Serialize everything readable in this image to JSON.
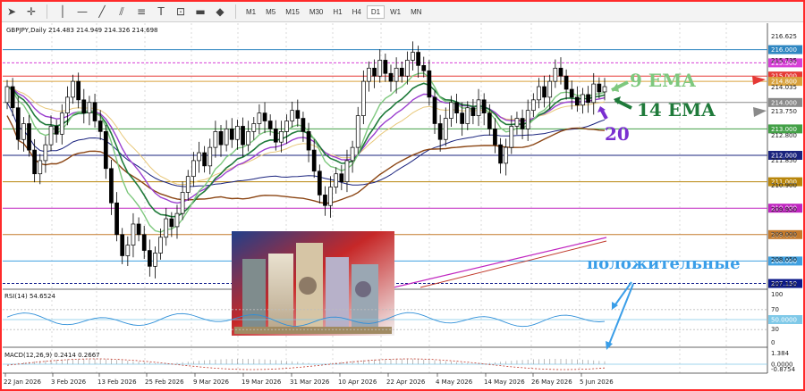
{
  "toolbar": {
    "timeframes": [
      "M1",
      "M5",
      "M15",
      "M30",
      "H1",
      "H4",
      "D1",
      "W1",
      "MN"
    ],
    "active_timeframe": "D1",
    "tools": [
      "cursor-icon",
      "crosshair-icon",
      "vertical-line-icon",
      "horizontal-line-icon",
      "trendline-icon",
      "channel-icon",
      "fibonacci-icon",
      "text-icon",
      "label-icon",
      "rectangle-icon",
      "shapes-icon"
    ]
  },
  "chart_header": "GBPJPY,Daily  214.483 214.949 214.326 214.698",
  "price_axis": {
    "labels": [
      "216.625",
      "215.735",
      "214.035",
      "213.750",
      "212.800",
      "211.850",
      "210.900",
      "209.950",
      "209.000",
      "208.050",
      "207.150"
    ],
    "levels": [
      {
        "price": "216.000",
        "color": "#2e86c1"
      },
      {
        "price": "215.500",
        "color": "#d63fd6"
      },
      {
        "price": "215.000",
        "color": "#e53935"
      },
      {
        "price": "214.800",
        "color": "#d9a23d"
      },
      {
        "price": "214.000",
        "color": "#8a8a8a"
      },
      {
        "price": "213.000",
        "color": "#43a047"
      },
      {
        "price": "212.000",
        "color": "#1a237e"
      },
      {
        "price": "211.000",
        "color": "#b8860b"
      },
      {
        "price": "210.000",
        "color": "#c026c0"
      },
      {
        "price": "209.000",
        "color": "#c47a2c"
      },
      {
        "price": "208.000",
        "color": "#3fa0e0"
      },
      {
        "price": "207.150",
        "color": "#0d1a8a"
      }
    ]
  },
  "annotations": {
    "ema9": "9 EMA",
    "ema14": "14 EMA",
    "ema20": "20",
    "positive": "положительные"
  },
  "rsi": {
    "header": "RSI(14) 54.6524",
    "scale": [
      "100",
      "70",
      "50",
      "30",
      "0"
    ],
    "current": "50.0000"
  },
  "macd": {
    "header": "MACD(12,26,9) 0.2414 0.2667",
    "scale": [
      "1.384",
      "0.0000",
      "-0.8754"
    ]
  },
  "date_axis": [
    "22 Jan 2026",
    "3 Feb 2026",
    "13 Feb 2026",
    "25 Feb 2026",
    "9 Mar 2026",
    "19 Mar 2026",
    "31 Mar 2026",
    "10 Apr 2026",
    "22 Apr 2026",
    "4 May 2026",
    "14 May 2026",
    "26 May 2026",
    "5 Jun 2026"
  ],
  "colors": {
    "frame": "#ff2a2a",
    "ema9": "#7ec87e",
    "ema14": "#1f7a3a",
    "ema20": "#9b3fcf",
    "positive": "#3a9ee8"
  }
}
